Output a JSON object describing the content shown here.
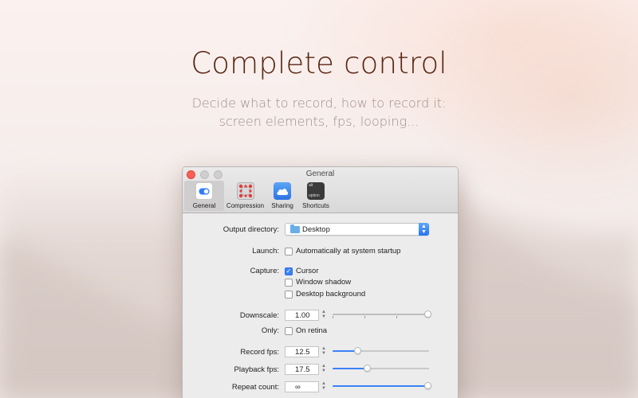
{
  "headline": "Complete control",
  "subline": [
    "Decide what to record, how to record it:",
    "screen elements, fps, looping..."
  ],
  "window": {
    "title": "General",
    "tabs": [
      {
        "label": "General",
        "icon": "toggle-icon",
        "active": true
      },
      {
        "label": "Compression",
        "icon": "compression-icon",
        "active": false
      },
      {
        "label": "Sharing",
        "icon": "cloud-icon",
        "active": false
      },
      {
        "label": "Shortcuts",
        "icon": "keyboard-option-icon",
        "active": false
      }
    ],
    "shortcut_icon_text": [
      "alt",
      "option"
    ]
  },
  "settings": {
    "output_directory": {
      "label": "Output directory:",
      "value": "Desktop"
    },
    "launch": {
      "label": "Launch:",
      "option": "Automatically at system startup",
      "checked": false
    },
    "capture": {
      "label": "Capture:",
      "options": [
        {
          "text": "Cursor",
          "checked": true
        },
        {
          "text": "Window shadow",
          "checked": false
        },
        {
          "text": "Desktop background",
          "checked": false
        }
      ]
    },
    "downscale": {
      "label": "Downscale:",
      "value": "1.00",
      "level": 1.0
    },
    "only": {
      "label": "Only:",
      "option": "On retina",
      "checked": false
    },
    "record_fps": {
      "label": "Record fps:",
      "value": "12.5",
      "level": 0.25
    },
    "playback_fps": {
      "label": "Playback fps:",
      "value": "17.5",
      "level": 0.35
    },
    "repeat_count": {
      "label": "Repeat count:",
      "value": "∞",
      "level": 1.0
    }
  },
  "colors": {
    "accent": "#3b82f7",
    "headline": "#5a2512",
    "subline": "#a28c86",
    "close": "#fc5f57"
  }
}
